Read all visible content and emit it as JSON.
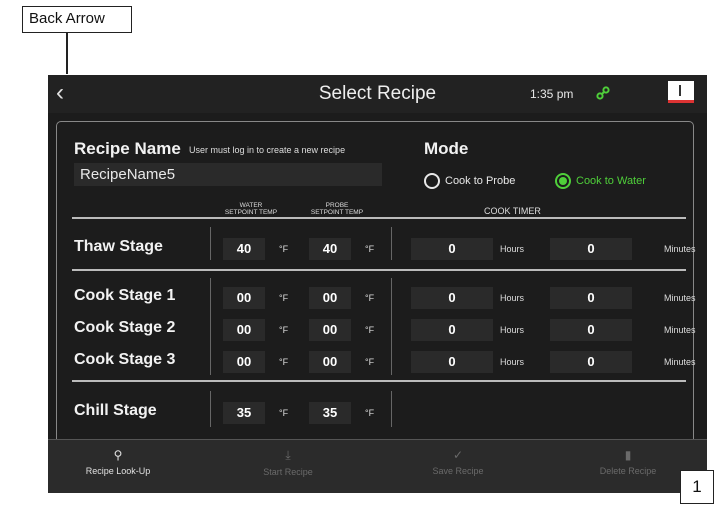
{
  "annotations": {
    "callout": "Back Arrow",
    "badge": "1"
  },
  "topbar": {
    "back": "‹",
    "title": "Select Recipe",
    "time": "1:35 pm"
  },
  "recipe": {
    "label": "Recipe Name",
    "hint": "User must log in to create a new recipe",
    "value": "RecipeName5"
  },
  "mode": {
    "label": "Mode",
    "options": [
      {
        "label": "Cook to Probe",
        "selected": false
      },
      {
        "label": "Cook to Water",
        "selected": true
      }
    ],
    "accent": "#4fcf3a"
  },
  "columns": {
    "water": [
      "WATER",
      "SETPOINT TEMP"
    ],
    "probe": [
      "PROBE",
      "SETPOINT TEMP"
    ],
    "cooktimer": "COOK TIMER"
  },
  "units": {
    "temp": "°F",
    "hours": "Hours",
    "minutes": "Minutes"
  },
  "stages": [
    {
      "name": "Thaw Stage",
      "water": "40",
      "probe": "40",
      "hours": "0",
      "minutes": "0"
    },
    {
      "name": "Cook Stage 1",
      "water": "00",
      "probe": "00",
      "hours": "0",
      "minutes": "0"
    },
    {
      "name": "Cook Stage 2",
      "water": "00",
      "probe": "00",
      "hours": "0",
      "minutes": "0"
    },
    {
      "name": "Cook Stage 3",
      "water": "00",
      "probe": "00",
      "hours": "0",
      "minutes": "0"
    },
    {
      "name": "Chill Stage",
      "water": "35",
      "probe": "35"
    }
  ],
  "bottombar": [
    {
      "label": "Recipe Look-Up",
      "icon": "search-icon",
      "enabled": true
    },
    {
      "label": "Start Recipe",
      "icon": "download-icon",
      "enabled": false
    },
    {
      "label": "Save Recipe",
      "icon": "check-circle-icon",
      "enabled": false
    },
    {
      "label": "Delete Recipe",
      "icon": "trash-icon",
      "enabled": false
    }
  ]
}
